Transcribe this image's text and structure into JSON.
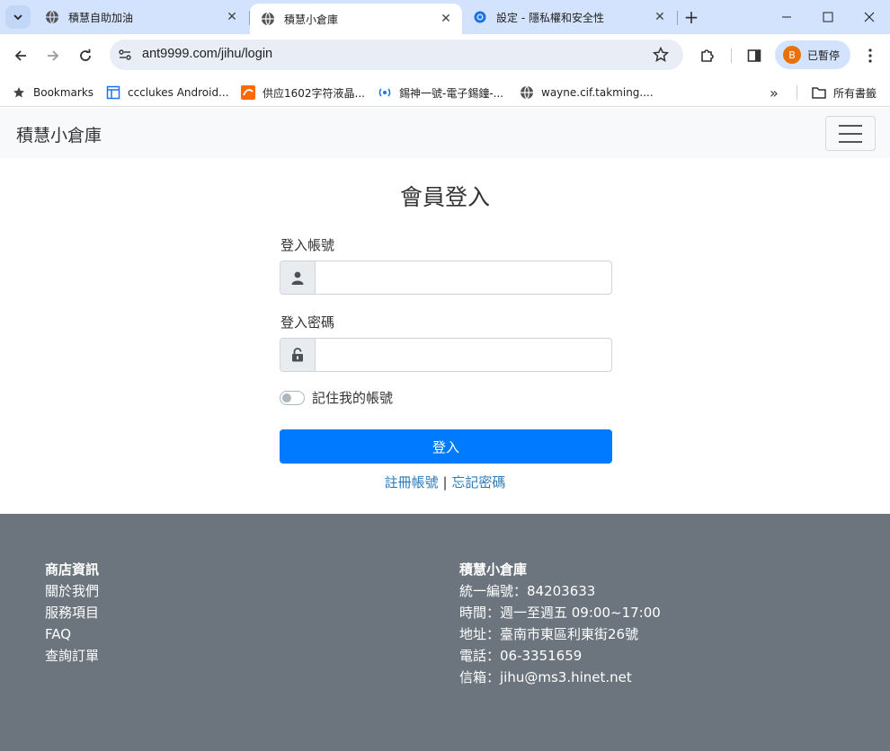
{
  "tabs": [
    {
      "title": "積慧自助加油",
      "icon": "globe-icon"
    },
    {
      "title": "積慧小倉庫",
      "icon": "globe-icon"
    },
    {
      "title": "設定 - 隱私權和安全性",
      "icon": "gear-icon"
    }
  ],
  "toolbar": {
    "url": "ant9999.com/jihu/login",
    "profile_initial": "B",
    "profile_label": "已暫停"
  },
  "bookmarks": {
    "items": [
      {
        "label": "Bookmarks",
        "icon": "star-icon"
      },
      {
        "label": "ccclukes Android...",
        "icon": "page-icon"
      },
      {
        "label": "供应1602字符液晶...",
        "icon": "alibaba-icon"
      },
      {
        "label": "錫神一號-電子錫鐘-...",
        "icon": "radio-icon"
      },
      {
        "label": "wayne.cif.takming....",
        "icon": "globe-icon"
      }
    ],
    "all_bookmarks": "所有書籤"
  },
  "navbar": {
    "brand": "積慧小倉庫"
  },
  "login": {
    "title": "會員登入",
    "account_label": "登入帳號",
    "password_label": "登入密碼",
    "remember_label": "記住我的帳號",
    "submit_label": "登入",
    "register_link": "註冊帳號",
    "separator": "|",
    "forgot_link": "忘記密碼"
  },
  "footer": {
    "left": {
      "heading": "商店資訊",
      "links": [
        "關於我們",
        "服務項目",
        "FAQ",
        "查詢訂單"
      ]
    },
    "right": {
      "heading": "積慧小倉庫",
      "lines": [
        "統一編號：84203633",
        "時間：週一至週五 09:00~17:00",
        "地址：臺南市東區利東街26號",
        "電話：06-3351659",
        "信箱：jihu@ms3.hinet.net"
      ]
    }
  },
  "colors": {
    "primary": "#007bff",
    "footer_bg": "#6c757d",
    "tabstrip": "#d3e3fd"
  }
}
